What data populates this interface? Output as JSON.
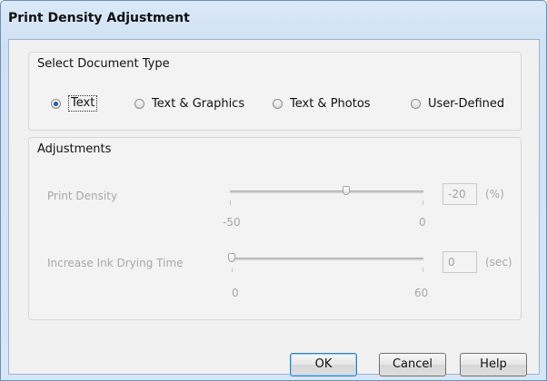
{
  "window": {
    "title": "Print Density Adjustment"
  },
  "document_type": {
    "label": "Select Document Type",
    "options": [
      {
        "label": "Text",
        "selected": true
      },
      {
        "label": "Text & Graphics",
        "selected": false
      },
      {
        "label": "Text & Photos",
        "selected": false
      },
      {
        "label": "User-Defined",
        "selected": false
      }
    ]
  },
  "adjustments": {
    "label": "Adjustments",
    "print_density": {
      "label": "Print Density",
      "value": "-20",
      "unit": "(%)",
      "min_label": "-50",
      "max_label": "0",
      "slider_value": -20,
      "slider_min": -50,
      "slider_max": 0
    },
    "drying_time": {
      "label": "Increase Ink Drying Time",
      "value": "0",
      "unit": "(sec)",
      "min_label": "0",
      "max_label": "60",
      "slider_value": 0,
      "slider_min": 0,
      "slider_max": 60
    }
  },
  "buttons": {
    "ok": "OK",
    "cancel": "Cancel",
    "help": "Help"
  }
}
